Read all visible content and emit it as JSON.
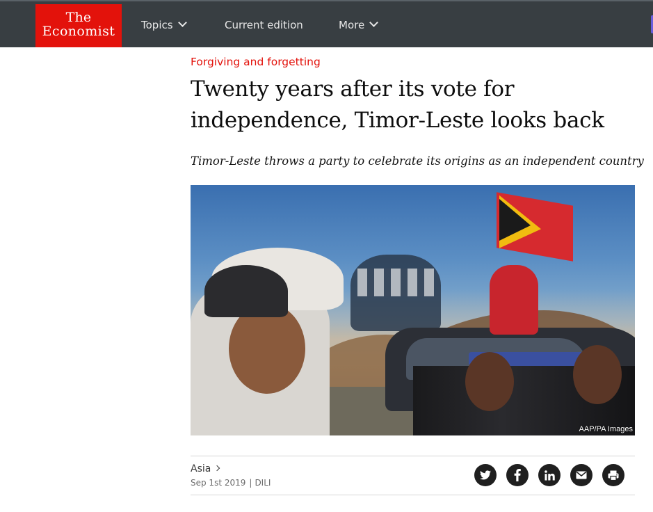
{
  "brand": {
    "logo_line1": "The",
    "logo_line2": "Economist",
    "color": "#e3120b"
  },
  "nav": {
    "items": [
      {
        "label": "Topics",
        "has_dropdown": true
      },
      {
        "label": "Current edition",
        "has_dropdown": false
      },
      {
        "label": "More",
        "has_dropdown": true
      }
    ],
    "background": "#383e42"
  },
  "article": {
    "rubric": "Forgiving and forgetting",
    "headline": "Twenty years after its vote for independence, Timor-Leste looks back",
    "subheadline": "Timor-Leste throws a party to celebrate its origins as an independent country",
    "image": {
      "credit": "AAP/PA Images"
    },
    "section": "Asia",
    "date": "Sep 1st 2019",
    "separator": "|",
    "dateline": "DILI"
  },
  "share": {
    "icons": [
      "twitter-icon",
      "facebook-icon",
      "linkedin-icon",
      "email-icon",
      "print-icon"
    ]
  }
}
